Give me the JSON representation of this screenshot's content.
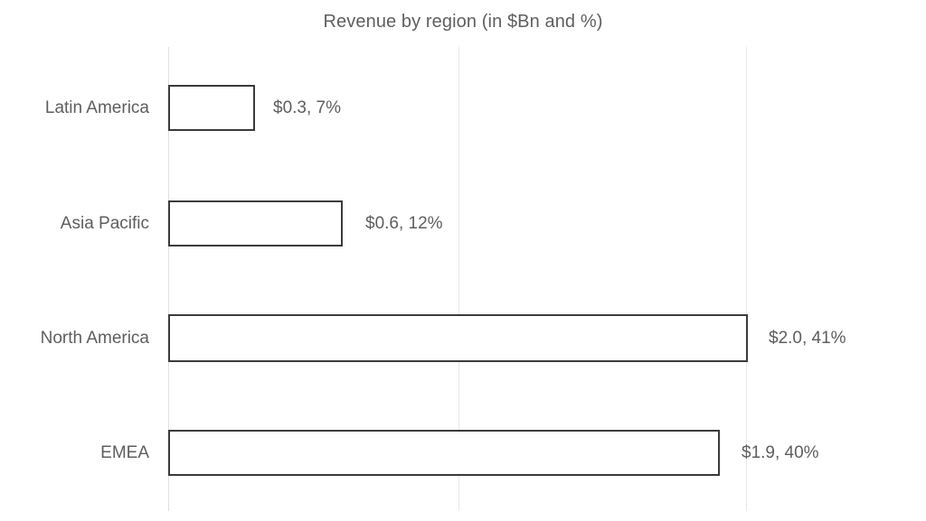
{
  "chart_data": {
    "type": "bar",
    "orientation": "horizontal",
    "title": "Revenue by region (in $Bn and %)",
    "xlabel": "",
    "ylabel": "",
    "xlim": [
      0,
      2.55
    ],
    "grid": true,
    "gridlines_x": [
      0,
      1.0,
      2.0
    ],
    "legend": "none",
    "tick_labels_x": [],
    "categories": [
      "Latin America",
      "Asia Pacific",
      "North America",
      "EMEA"
    ],
    "values": [
      0.3,
      0.6,
      2.0,
      1.9
    ],
    "percent": [
      7,
      12,
      41,
      40
    ],
    "data_labels": [
      "$0.3, 7%",
      "$0.6, 12%",
      "$2.0, 41%",
      "$1.9, 40%"
    ],
    "series": [
      {
        "name": "Revenue",
        "values": [
          0.3,
          0.6,
          2.0,
          1.9
        ]
      }
    ],
    "colors": {
      "bar_fill": "#ffffff",
      "bar_border": "#3b3b3b",
      "text": "#5e5e5e",
      "gridline": "#e8e8e8",
      "background": "#ffffff"
    }
  },
  "chart": {
    "title": "Revenue by region (in $Bn and %)",
    "rows": [
      {
        "label": "Latin America",
        "value_label": "$0.3, 7%"
      },
      {
        "label": "Asia Pacific",
        "value_label": "$0.6, 12%"
      },
      {
        "label": "North America",
        "value_label": "$2.0, 41%"
      },
      {
        "label": "EMEA",
        "value_label": "$1.9, 40%"
      }
    ]
  }
}
